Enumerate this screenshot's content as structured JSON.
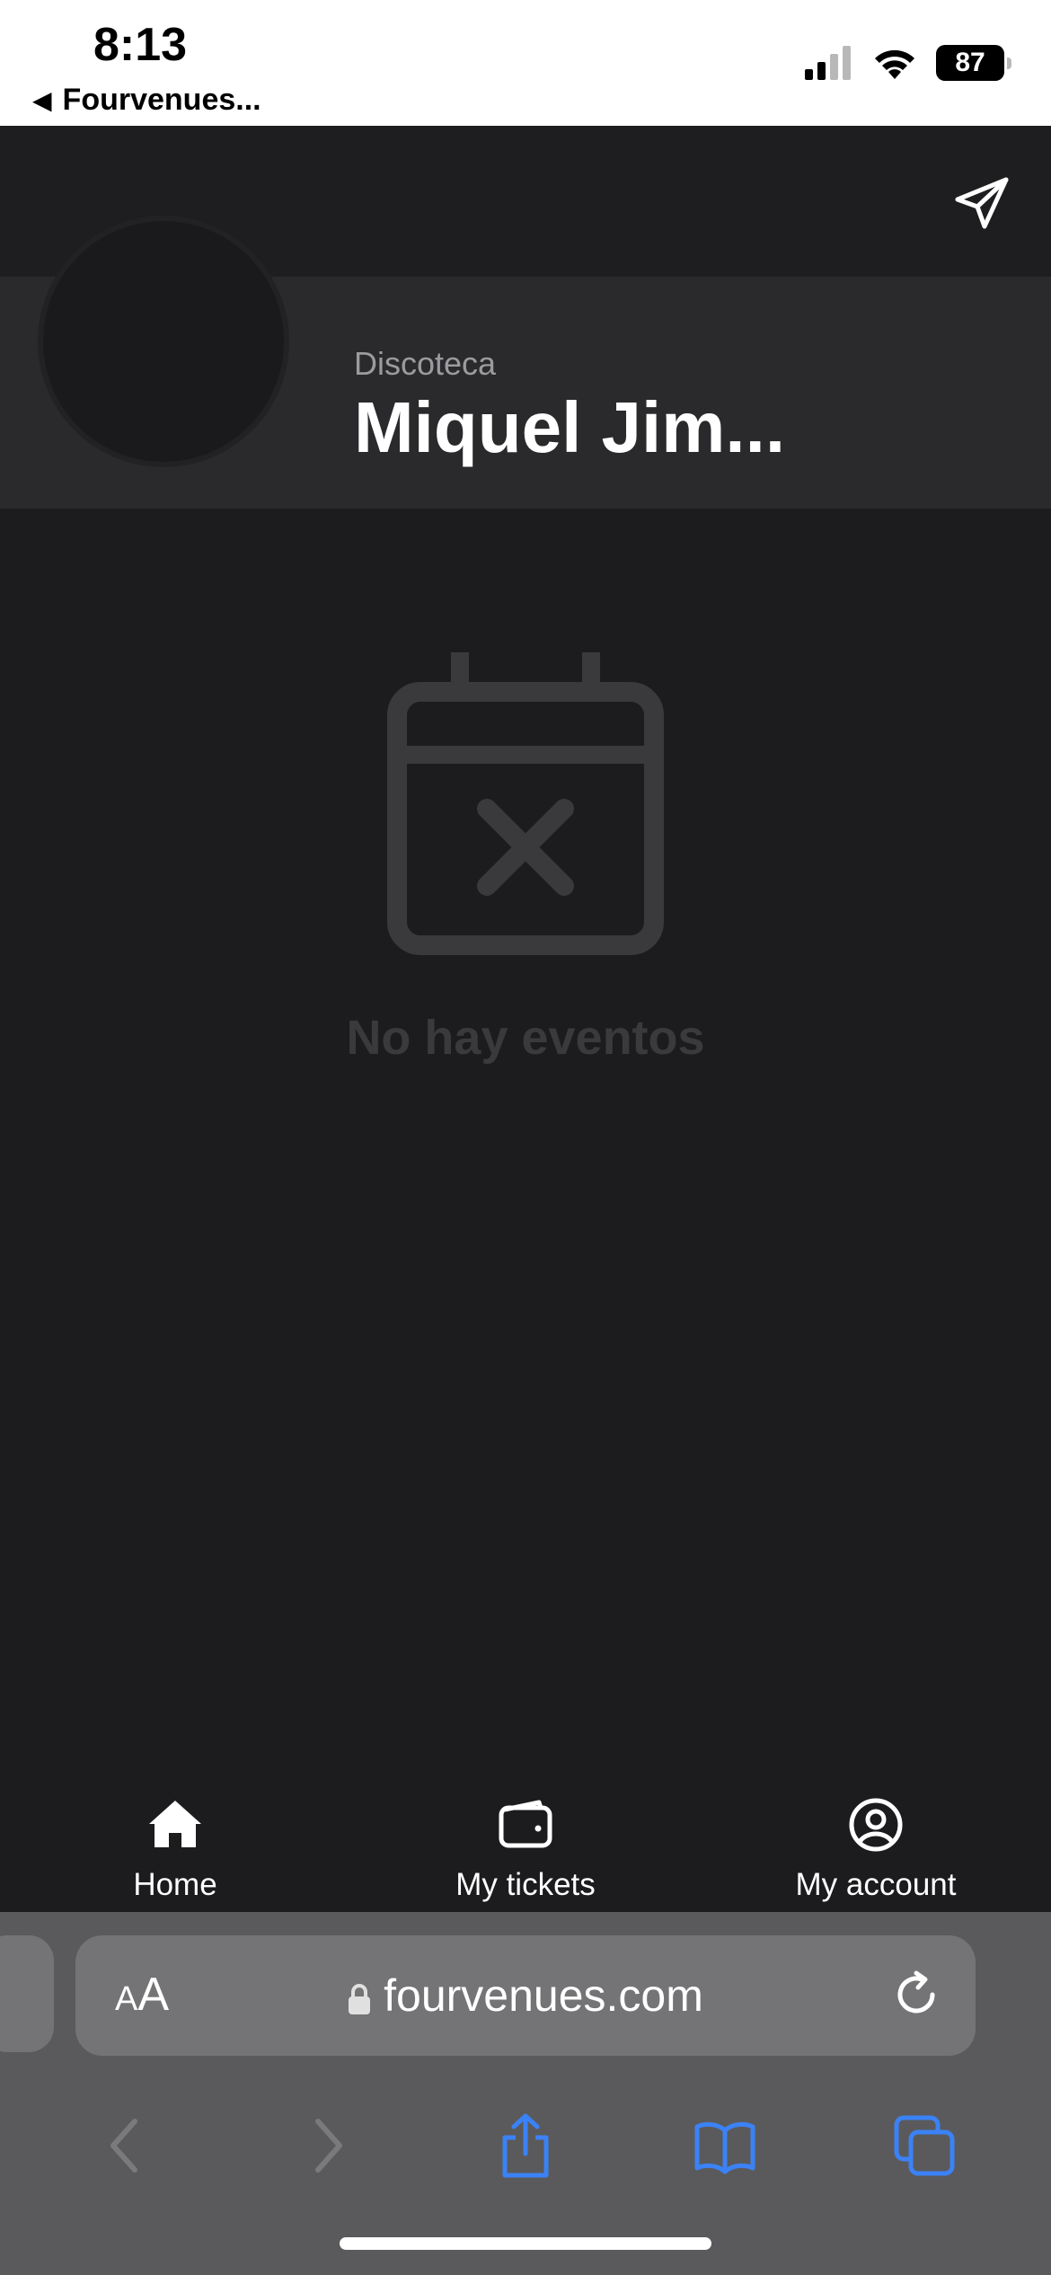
{
  "status_bar": {
    "time": "8:13",
    "back_app": "Fourvenues...",
    "battery": "87"
  },
  "venue": {
    "type": "Discoteca",
    "name": "Miquel Jim..."
  },
  "empty_state": {
    "message": "No hay eventos"
  },
  "bottom_nav": {
    "items": [
      {
        "label": "Home",
        "icon": "home-icon"
      },
      {
        "label": "My tickets",
        "icon": "wallet-icon"
      },
      {
        "label": "My account",
        "icon": "account-icon"
      }
    ]
  },
  "browser": {
    "text_size_label": "AA",
    "url": "fourvenues.com"
  },
  "colors": {
    "background": "#1c1c1e",
    "accent": "#3b82f6",
    "muted": "#3a3a3d"
  }
}
